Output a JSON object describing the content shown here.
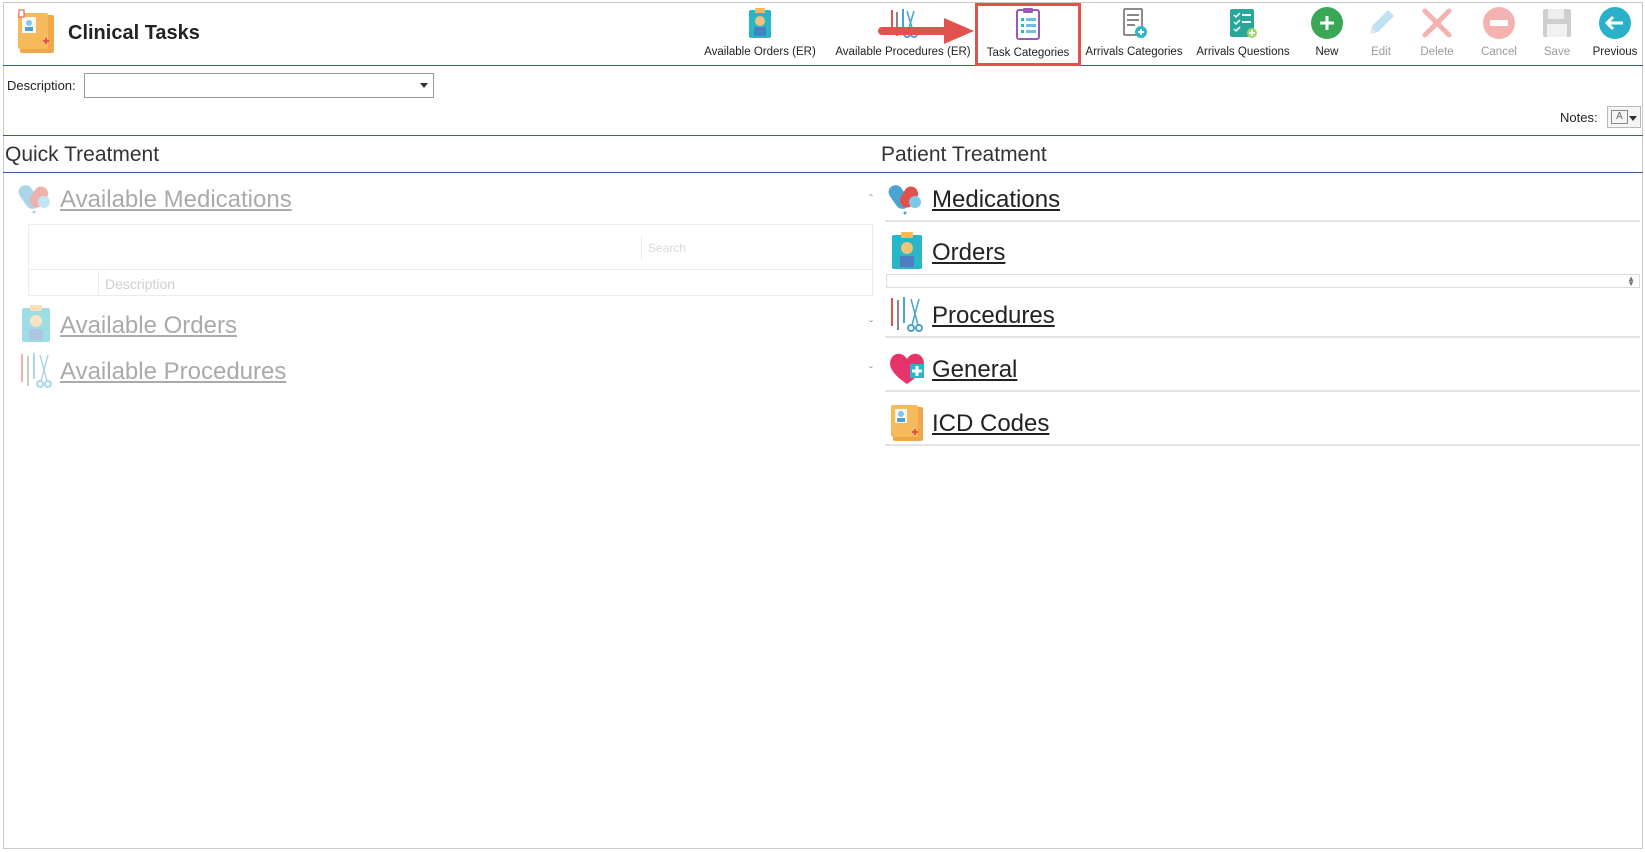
{
  "app": {
    "title": "Clinical Tasks"
  },
  "toolbar": {
    "available_orders": "Available Orders (ER)",
    "available_procedures": "Available Procedures (ER)",
    "task_categories": "Task Categories",
    "arrivals_categories": "Arrivals Categories",
    "arrivals_questions": "Arrivals Questions",
    "new": "New",
    "edit": "Edit",
    "delete": "Delete",
    "cancel": "Cancel",
    "save": "Save",
    "previous": "Previous"
  },
  "filter": {
    "description_label": "Description:",
    "description_value": ""
  },
  "notes": {
    "label": "Notes:"
  },
  "quick_treatment": {
    "title": "Quick Treatment",
    "items": [
      {
        "label": "Available Medications",
        "chevron": "^"
      },
      {
        "label": "Available Orders",
        "chevron": "v"
      },
      {
        "label": "Available Procedures",
        "chevron": "v"
      }
    ],
    "grid": {
      "search_placeholder": "Search",
      "column_header": "Description"
    }
  },
  "patient_treatment": {
    "title": "Patient Treatment",
    "items": [
      {
        "label": "Medications"
      },
      {
        "label": "Orders"
      },
      {
        "label": "Procedures"
      },
      {
        "label": "General"
      },
      {
        "label": "ICD Codes"
      }
    ]
  },
  "colors": {
    "accent_line": "#2f5f9e",
    "highlight_border": "#e0524b",
    "new_green": "#3aa757",
    "previous_teal": "#2bb0c9"
  }
}
